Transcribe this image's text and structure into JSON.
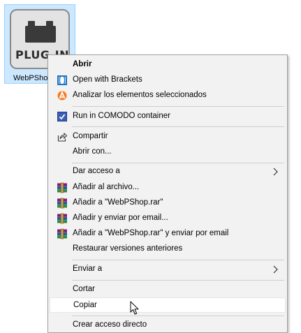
{
  "file": {
    "icon_text": "PLUG-IN",
    "name": "WebPShop"
  },
  "menu": {
    "open": "Abrir",
    "open_brackets": "Open with Brackets",
    "analyze": "Analizar los elementos seleccionados",
    "comodo": "Run in COMODO container",
    "share": "Compartir",
    "open_with": "Abrir con...",
    "give_access": "Dar acceso a",
    "add_archive": "Añadir al archivo...",
    "add_rar": "Añadir a \"WebPShop.rar\"",
    "add_email": "Añadir y enviar por email...",
    "add_rar_email": "Añadir a \"WebPShop.rar\" y enviar por email",
    "restore": "Restaurar versiones anteriores",
    "send_to": "Enviar a",
    "cut": "Cortar",
    "copy": "Copiar",
    "create_shortcut": "Crear acceso directo"
  },
  "icons": {
    "brackets": "brackets-icon",
    "avast": "avast-icon",
    "comodo": "comodo-icon",
    "share": "share-icon",
    "winrar": "winrar-icon",
    "arrow": "chevron-right-icon",
    "cursor": "mouse-cursor-icon"
  },
  "colors": {
    "menu_bg": "#f2f2f2",
    "hover_bg": "#ffffff",
    "selection_bg": "#cce8ff",
    "selection_border": "#99d1ff",
    "brackets_blue": "#1e74c6",
    "avast_orange": "#f47c20"
  }
}
